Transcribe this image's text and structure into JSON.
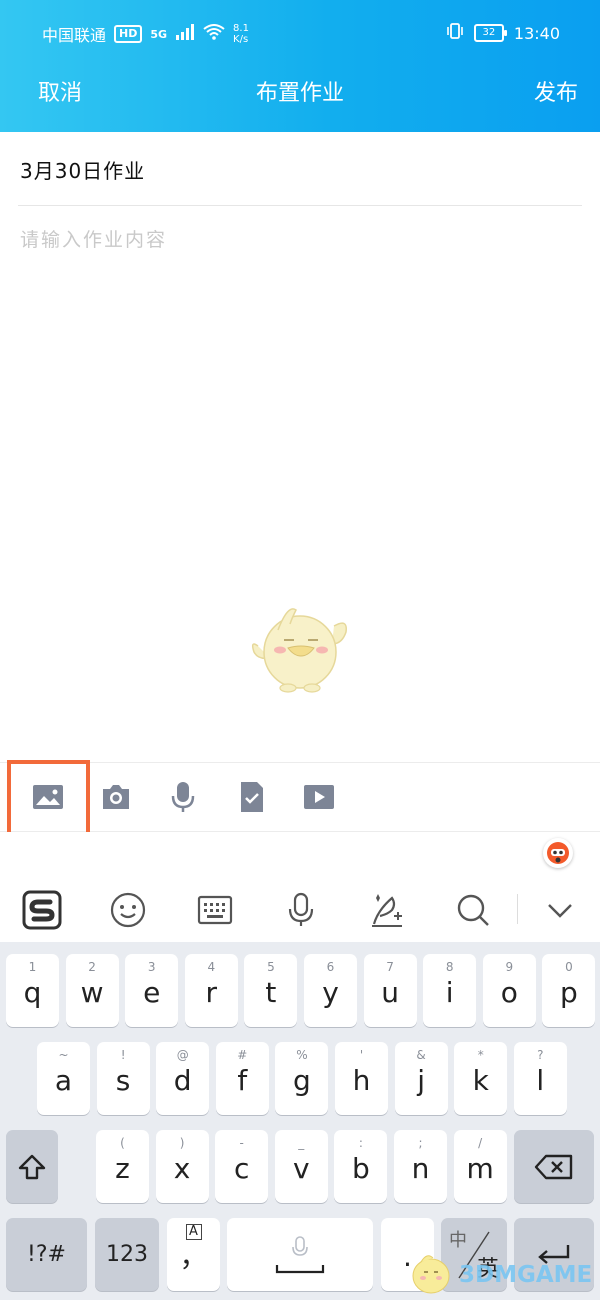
{
  "status_bar": {
    "carrier": "中国联通",
    "hd": "HD",
    "network": "5G",
    "speed_value": "8.1",
    "speed_unit": "K/s",
    "battery": "32",
    "time": "13:40"
  },
  "nav": {
    "cancel": "取消",
    "title": "布置作业",
    "publish": "发布"
  },
  "homework": {
    "title": "3月30日作业",
    "content_placeholder": "请输入作业内容",
    "content_value": ""
  },
  "toolbar": {
    "items": [
      "image-icon",
      "camera-icon",
      "microphone-icon",
      "document-check-icon",
      "video-icon"
    ],
    "icon_color": "#7d8596",
    "highlight_color": "#f26a3a"
  },
  "keyboard_toolbar": {
    "items": [
      "sogou-logo-icon",
      "emoji-icon",
      "keyboard-icon",
      "voice-icon",
      "handwriting-icon",
      "search-icon",
      "collapse-icon"
    ]
  },
  "keyboard": {
    "row1": [
      {
        "sub": "1",
        "key": "q"
      },
      {
        "sub": "2",
        "key": "w"
      },
      {
        "sub": "3",
        "key": "e"
      },
      {
        "sub": "4",
        "key": "r"
      },
      {
        "sub": "5",
        "key": "t"
      },
      {
        "sub": "6",
        "key": "y"
      },
      {
        "sub": "7",
        "key": "u"
      },
      {
        "sub": "8",
        "key": "i"
      },
      {
        "sub": "9",
        "key": "o"
      },
      {
        "sub": "0",
        "key": "p"
      }
    ],
    "row2": [
      {
        "sub": "~",
        "key": "a"
      },
      {
        "sub": "!",
        "key": "s"
      },
      {
        "sub": "@",
        "key": "d"
      },
      {
        "sub": "#",
        "key": "f"
      },
      {
        "sub": "%",
        "key": "g"
      },
      {
        "sub": "'",
        "key": "h"
      },
      {
        "sub": "&",
        "key": "j"
      },
      {
        "sub": "*",
        "key": "k"
      },
      {
        "sub": "?",
        "key": "l"
      }
    ],
    "row3": [
      {
        "sub": "(",
        "key": "z"
      },
      {
        "sub": ")",
        "key": "x"
      },
      {
        "sub": "-",
        "key": "c"
      },
      {
        "sub": "_",
        "key": "v"
      },
      {
        "sub": ":",
        "key": "b"
      },
      {
        "sub": ";",
        "key": "n"
      },
      {
        "sub": "/",
        "key": "m"
      }
    ],
    "symbols": "!?#",
    "numbers": "123",
    "comma_sub": "A",
    "comma": "，",
    "dot": ".",
    "lang_cn": "中",
    "lang_en": "英"
  },
  "watermark": {
    "text": "3DMGAME"
  }
}
